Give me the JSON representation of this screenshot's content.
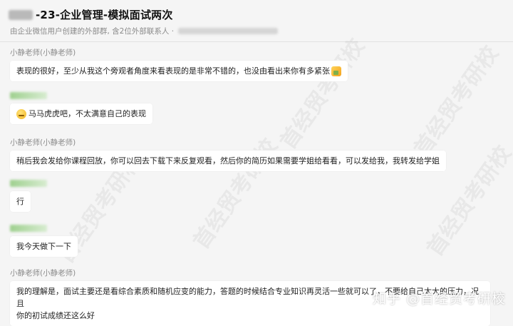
{
  "header": {
    "title": "-23-企业管理-模拟面试两次",
    "subtitle": "由企业微信用户创建的外部群, 含2位外部联系人 ·"
  },
  "messages": [
    {
      "sender": "小静老师(小静老师)",
      "text": "表现的很好，至少从我这个旁观者角度来看表现的是非常不错的，也没由看出来你有多紧张",
      "emoji": "thumbs-up-icon"
    },
    {
      "sender": "",
      "text": "马马虎虎吧，不太满意自己的表现",
      "emoji": "grin-icon"
    },
    {
      "sender": "小静老师(小静老师)",
      "text": "稍后我会发给你课程回放，你可以回去下载下来反复观看，然后你的简历如果需要学姐给看看，可以发给我，我转发给学姐"
    },
    {
      "sender": "",
      "text": "行"
    },
    {
      "sender": "",
      "text": "我今天做下一下"
    },
    {
      "sender": "小静老师(小静老师)",
      "lines": [
        "我的理解是，面试主要还是看综合素质和随机应变的能力，答题的时候结合专业知识再灵活一些就可以了，不要给自己太大的压力，况且",
        "你的初试成绩还这么好"
      ]
    }
  ],
  "watermark": "首经贸考研校",
  "source_watermark": "知乎 @首经贸考研校"
}
